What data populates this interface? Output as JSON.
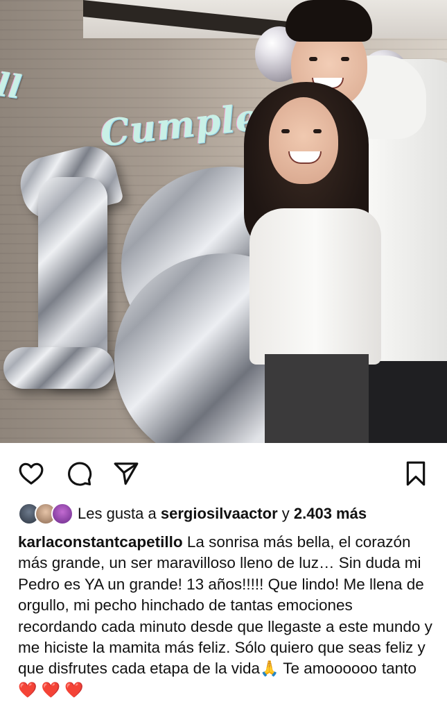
{
  "post": {
    "image_alt_icons": {
      "banner": "Cumpleaños",
      "balloon_number": "13"
    }
  },
  "actions": {
    "like_icon": "heart-outline-icon",
    "comment_icon": "comment-bubble-icon",
    "share_icon": "paper-plane-icon",
    "save_icon": "bookmark-outline-icon"
  },
  "likes": {
    "prefix": "Les gusta a",
    "user": "sergiosilvaactor",
    "conjunction": "y",
    "count": "2.403 más"
  },
  "caption": {
    "username": "karlaconstantcapetillo",
    "text": "La sonrisa más bella, el corazón más grande, un ser maravilloso lleno de luz… Sin duda mi Pedro es YA un grande! 13 años!!!!! Que lindo! Me llena de orgullo, mi pecho hinchado de tantas emociones recordando cada minuto desde que llegaste a este mundo y me hiciste la mamita más feliz. Sólo quiero que seas feliz y que disfrutes cada etapa de la vida",
    "pray_emoji": "🙏",
    "text_after": " Te amoooooo tanto",
    "hearts": [
      "❤️",
      "❤️",
      "❤️"
    ]
  }
}
